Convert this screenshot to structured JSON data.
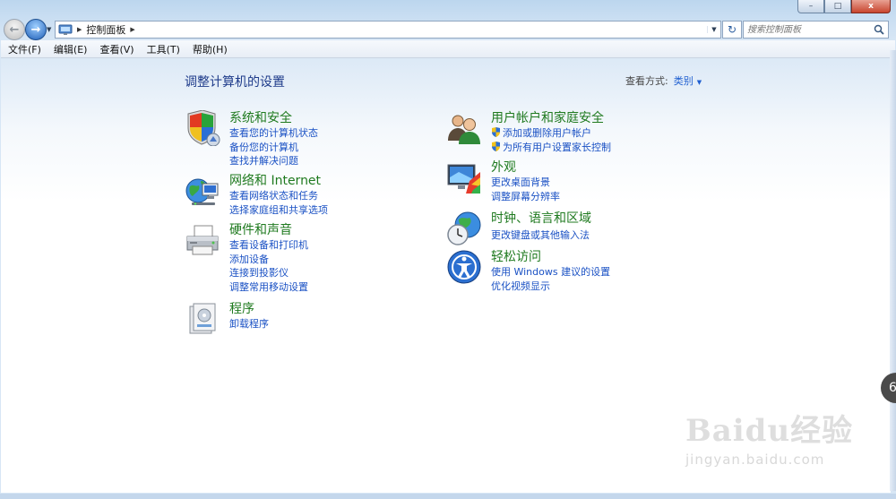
{
  "address_bar": {
    "breadcrumb": "控制面板",
    "search_placeholder": "搜索控制面板"
  },
  "window_controls": {
    "minimize": "–",
    "maximize": "□",
    "close": "x"
  },
  "menu": [
    "文件(F)",
    "编辑(E)",
    "查看(V)",
    "工具(T)",
    "帮助(H)"
  ],
  "page": {
    "title": "调整计算机的设置",
    "view_by_label": "查看方式:",
    "view_by_value": "类别"
  },
  "categories": [
    {
      "heading": "系统和安全",
      "icon": "shield-computer-icon",
      "links": [
        "查看您的计算机状态",
        "备份您的计算机",
        "查找并解决问题"
      ]
    },
    {
      "heading": "网络和 Internet",
      "icon": "globe-network-icon",
      "links": [
        "查看网络状态和任务",
        "选择家庭组和共享选项"
      ]
    },
    {
      "heading": "硬件和声音",
      "icon": "printer-icon",
      "links": [
        "查看设备和打印机",
        "添加设备",
        "连接到投影仪",
        "调整常用移动设置"
      ]
    },
    {
      "heading": "程序",
      "icon": "programs-icon",
      "links": [
        "卸载程序"
      ]
    },
    {
      "heading": "用户帐户和家庭安全",
      "icon": "users-icon",
      "links": [
        "添加或删除用户帐户",
        "为所有用户设置家长控制"
      ]
    },
    {
      "heading": "外观",
      "icon": "appearance-icon",
      "links": [
        "更改桌面背景",
        "调整屏幕分辨率"
      ]
    },
    {
      "heading": "时钟、语言和区域",
      "icon": "clock-globe-icon",
      "links": [
        "更改键盘或其他输入法"
      ]
    },
    {
      "heading": "轻松访问",
      "icon": "ease-of-access-icon",
      "links": [
        "使用 Windows 建议的设置",
        "优化视频显示"
      ]
    }
  ],
  "overlay": {
    "side_badge": "6",
    "watermark_logo": "Baidu经验",
    "watermark_url": "jingyan.baidu.com"
  }
}
